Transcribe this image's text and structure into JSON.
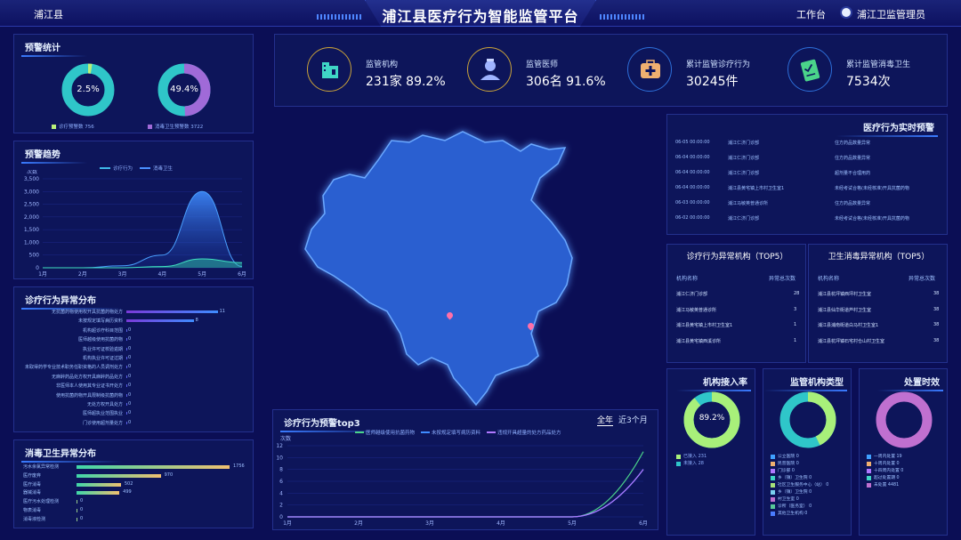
{
  "header": {
    "region": "浦江县",
    "title": "浦江县医疗行为智能监管平台",
    "workbench": "工作台",
    "user": "浦江卫监管理员"
  },
  "alert_stats": {
    "title": "预警统计",
    "donuts": [
      {
        "pct": "2.5%",
        "legend": "诊疗预警数 756",
        "value": 2.5,
        "color": "#b9f07a"
      },
      {
        "pct": "49.4%",
        "legend": "消毒卫生预警数 3722",
        "value": 49.4,
        "color": "#a06ad8"
      }
    ]
  },
  "trend": {
    "title": "预警趋势",
    "ylabel": "次数",
    "legend": [
      "诊疗行为",
      "消毒卫生"
    ]
  },
  "chart_data": [
    {
      "type": "area",
      "title": "预警趋势",
      "ylabel": "次数",
      "x": [
        "1月",
        "2月",
        "3月",
        "4月",
        "5月",
        "6月"
      ],
      "yticks": [
        "0",
        "500",
        "1,000",
        "1,500",
        "2,000",
        "2,500",
        "3,000",
        "3,500"
      ],
      "ylim": [
        0,
        3500
      ],
      "series": [
        {
          "name": "诊疗行为",
          "values": [
            0,
            0,
            0,
            50,
            350,
            200
          ]
        },
        {
          "name": "消毒卫生",
          "values": [
            0,
            0,
            80,
            500,
            3000,
            50
          ]
        }
      ]
    },
    {
      "type": "line",
      "title": "诊疗行为预警top3",
      "ylabel": "次数",
      "x": [
        "1月",
        "2月",
        "3月",
        "4月",
        "5月",
        "6月"
      ],
      "yticks": [
        "0",
        "2",
        "4",
        "6",
        "8",
        "10",
        "12"
      ],
      "ylim": [
        0,
        12
      ],
      "series": [
        {
          "name": "医师越级使用抗菌药物",
          "values": [
            0,
            0,
            0,
            0,
            0,
            11
          ]
        },
        {
          "name": "未按规定填写病历资料",
          "values": [
            0,
            0,
            0,
            0,
            0,
            8
          ]
        },
        {
          "name": "违规开具超量的处方药品处方",
          "values": [
            0,
            0,
            0,
            0,
            0,
            8
          ]
        }
      ]
    }
  ],
  "clinical_abnormal": {
    "title": "诊疗行为异常分布",
    "items": [
      {
        "label": "无抗菌药物使用权开具抗菌药物处方",
        "value": "11",
        "frac": 0.95
      },
      {
        "label": "未按规定填写病历资料",
        "value": "8",
        "frac": 0.7
      },
      {
        "label": "机构超诊疗科目范围",
        "value": "0",
        "frac": 0
      },
      {
        "label": "医师越级使用抗菌药物",
        "value": "0",
        "frac": 0
      },
      {
        "label": "执业许可证校验逾期",
        "value": "0",
        "frac": 0
      },
      {
        "label": "机构执业许可证过期",
        "value": "0",
        "frac": 0
      },
      {
        "label": "未取得药学专业技术职务任职资格的人员调剂处方",
        "value": "0",
        "frac": 0
      },
      {
        "label": "无麻醉药品处方权开具麻醉药品处方",
        "value": "0",
        "frac": 0
      },
      {
        "label": "非医师本人使用其专业证书开处方",
        "value": "0",
        "frac": 0
      },
      {
        "label": "使用抗菌药物开具限制级抗菌药物",
        "value": "0",
        "frac": 0
      },
      {
        "label": "无处方权开具处方",
        "value": "0",
        "frac": 0
      },
      {
        "label": "医师超执业范围执业",
        "value": "0",
        "frac": 0
      },
      {
        "label": "门诊使用超剂量处方",
        "value": "0",
        "frac": 0
      }
    ]
  },
  "hygiene_abnormal": {
    "title": "消毒卫生异常分布",
    "items": [
      {
        "label": "污水余氯异常检测",
        "value": "1756",
        "frac": 1.0
      },
      {
        "label": "医疗废弃",
        "value": "970",
        "frac": 0.55
      },
      {
        "label": "医疗消毒",
        "value": "502",
        "frac": 0.29
      },
      {
        "label": "器械消毒",
        "value": "499",
        "frac": 0.28
      },
      {
        "label": "医疗污水处理检测",
        "value": "0",
        "frac": 0
      },
      {
        "label": "物表消毒",
        "value": "0",
        "frac": 0
      },
      {
        "label": "消毒液检测",
        "value": "0",
        "frac": 0
      }
    ]
  },
  "kpis": [
    {
      "label": "监管机构",
      "value": "231家 89.2%",
      "icon": "hospital-icon",
      "color": "#3fd6c6"
    },
    {
      "label": "监管医师",
      "value": "306名 91.6%",
      "icon": "doctor-icon",
      "color": "#9fb4ff"
    },
    {
      "label": "累计监管诊疗行为",
      "value": "30245件",
      "icon": "medkit-icon",
      "color": "#f0b070"
    },
    {
      "label": "累计监管消毒卫生",
      "value": "7534次",
      "icon": "checklist-icon",
      "color": "#4ad38a"
    }
  ],
  "realtime": {
    "title": "医疗行为实时预警",
    "rows": [
      {
        "time": "06-05 00:00:00",
        "org": "浦江仁济门诊部",
        "desc": "住方药品数量异常"
      },
      {
        "time": "06-04 00:00:00",
        "org": "浦江仁济门诊部",
        "desc": "住方药品数量异常"
      },
      {
        "time": "06-04 00:00:00",
        "org": "浦江仁济门诊部",
        "desc": "超剂量不合理用药"
      },
      {
        "time": "06-04 00:00:00",
        "org": "浦江县黄宅镇上市村卫生室1",
        "desc": "未经考试合格(未经核准)开具抗菌药物"
      },
      {
        "time": "06-03 00:00:00",
        "org": "浦江马敏英普通诊所",
        "desc": "住方药品数量异常"
      },
      {
        "time": "06-02 00:00:00",
        "org": "浦江仁济门诊部",
        "desc": "未经考试合格(未经核准)开具抗菌药物"
      }
    ]
  },
  "top5_clinical": {
    "title": "诊疗行为异常机构（TOP5）",
    "col1": "机构名称",
    "col2": "异常总次数",
    "rows": [
      {
        "name": "浦江仁济门诊部",
        "count": "28"
      },
      {
        "name": "浦江马敏英普通诊所",
        "count": "3"
      },
      {
        "name": "浦江县黄宅镇上市村卫生室1",
        "count": "1"
      },
      {
        "name": "浦江县黄宅镇西溪诊所",
        "count": "1"
      }
    ]
  },
  "top5_hygiene": {
    "title": "卫生消毒异常机构（TOP5）",
    "col1": "机构名称",
    "col2": "异常总次数",
    "rows": [
      {
        "name": "浦江县杭坪镇西坪村卫生室",
        "count": "38"
      },
      {
        "name": "浦江县仙华街道芦村卫生室",
        "count": "38"
      },
      {
        "name": "浦江县浦南街道白马村卫生室1",
        "count": "38"
      },
      {
        "name": "浦江县杭坪镇石宅村仓山村卫生室",
        "count": "38"
      }
    ]
  },
  "access_rate": {
    "title": "机构接入率",
    "pct": "89.2%",
    "value": 89.2,
    "legend": [
      "已接入 231",
      "未接入 28"
    ]
  },
  "org_types": {
    "title": "监管机构类型",
    "legend": [
      "公立医院 0",
      "民营医院 0",
      "门诊部 0",
      "乡（镇）卫生院 0",
      "社区卫生服务中心（站） 0",
      "乡（镇）卫生院 0",
      "村卫生室 0",
      "诊所（医务室） 0",
      "其他卫生机构 0"
    ],
    "colors": [
      "#3fa0ff",
      "#f0b070",
      "#b078ff",
      "#3fd6c6",
      "#a6e07a",
      "#7ad0f0",
      "#c070d0",
      "#58c898",
      "#4a7cff"
    ]
  },
  "handling": {
    "title": "处置时效",
    "legend": [
      "一周内处置 19",
      "十周内处置 0",
      "十四周内处置 0",
      "超过处置期 0",
      "未处置 4481"
    ],
    "colors": [
      "#3fa0ff",
      "#f0b070",
      "#b078ff",
      "#3fd6c6",
      "#c070d0"
    ]
  },
  "top3": {
    "title": "诊疗行为预警top3",
    "tabs": [
      "全年",
      "近3个月"
    ],
    "ylabel": "次数",
    "legend": [
      "医师越级使用抗菌药物",
      "未按规定填写病历资料",
      "违规开具超量的处方药品处方"
    ]
  }
}
